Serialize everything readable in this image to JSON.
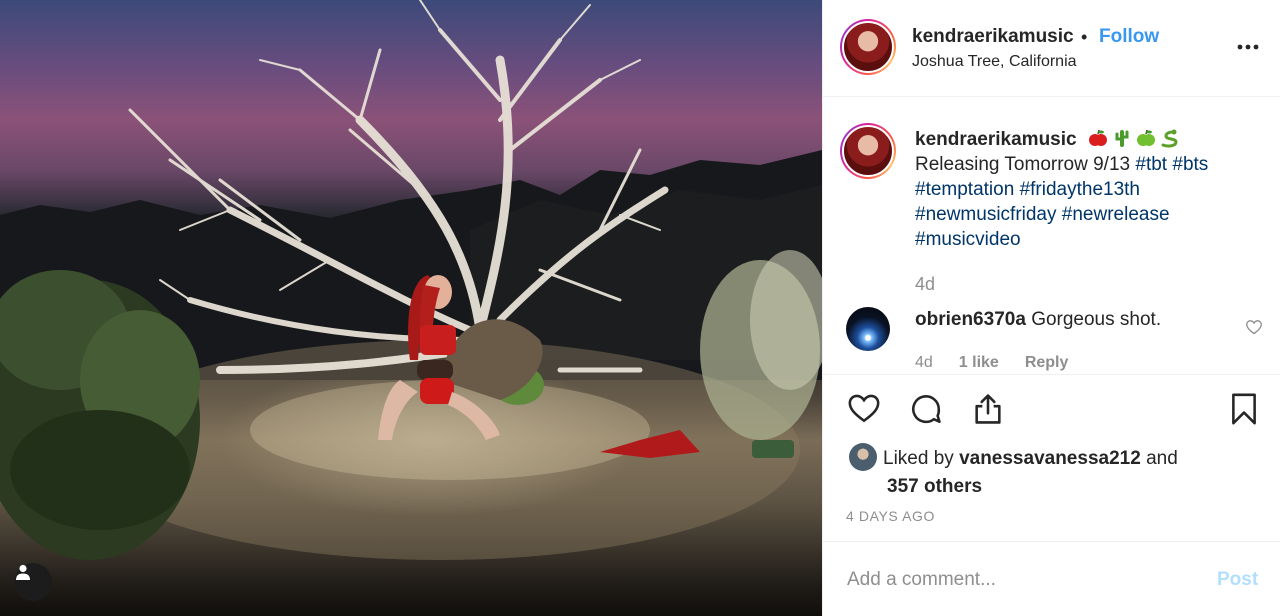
{
  "post": {
    "username": "kendraerikamusic",
    "separator": "•",
    "follow_label": "Follow",
    "location": "Joshua Tree, California",
    "more_icon": "more-options-icon"
  },
  "caption": {
    "username": "kendraerikamusic",
    "emojis": [
      "apple-red",
      "cactus",
      "apple-green",
      "snake"
    ],
    "text": "Releasing Tomorrow 9/13",
    "hashtags": [
      "#tbt",
      "#bts",
      "#temptation",
      "#fridaythe13th",
      "#newmusicfriday",
      "#newrelease",
      "#musicvideo"
    ],
    "time": "4d"
  },
  "comment": {
    "username": "obrien6370a",
    "text": "Gorgeous shot.",
    "time": "4d",
    "likes": "1 like",
    "reply_label": "Reply"
  },
  "actions": {
    "icons": [
      "heart-icon",
      "comment-icon",
      "share-icon",
      "bookmark-icon"
    ]
  },
  "likes": {
    "prefix": "Liked by",
    "user": "vanessavanessa212",
    "conj": "and",
    "others": "357 others"
  },
  "timestamp": "4 DAYS AGO",
  "add_comment": {
    "placeholder": "Add a comment...",
    "post_label": "Post"
  },
  "colors": {
    "link": "#003569",
    "follow": "#3897f0",
    "post_disabled": "#b2dffc",
    "muted": "#8e8e8e"
  }
}
